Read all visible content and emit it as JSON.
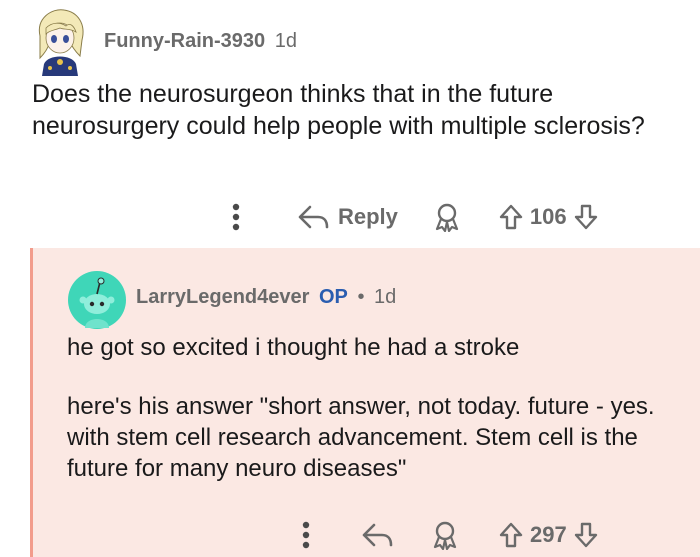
{
  "top_comment": {
    "username": "Funny-Rain-3930",
    "time": "1d",
    "body": "Does the neurosurgeon thinks that in the future neurosurgery could help people with multiple sclerosis?",
    "actions": {
      "reply_label": "Reply",
      "vote_count": "106",
      "more_icon": "more-vertical-icon",
      "reply_icon": "reply-arrow-icon",
      "award_icon": "award-icon",
      "upvote_icon": "upvote-arrow-icon",
      "downvote_icon": "downvote-arrow-icon"
    }
  },
  "reply_comment": {
    "username": "LarryLegend4ever",
    "op_badge": "OP",
    "separator": "•",
    "time": "1d",
    "paragraphs": [
      "he got so excited i thought he had a stroke",
      "here's his answer \"short answer, not today. future - yes. with stem cell research advancement. Stem cell is the future for many neuro diseases\""
    ],
    "actions": {
      "vote_count": "297"
    },
    "highlight_color": "#fbe8e3",
    "border_color": "#f29c8c"
  },
  "colors": {
    "op_badge": "#2a5db0",
    "meta_text": "#6a6a6a",
    "snoo_avatar_bg": "#3fd6b8"
  }
}
